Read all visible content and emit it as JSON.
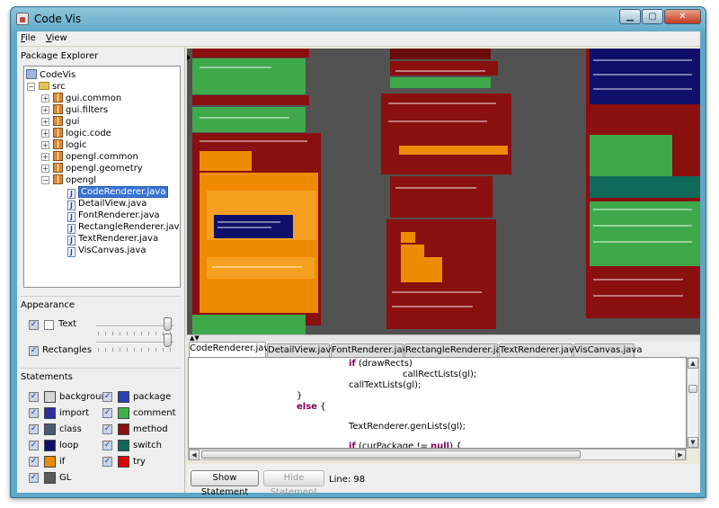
{
  "window": {
    "title": "Code Vis",
    "controls": {
      "minimize": "▁",
      "maximize": "▢",
      "close": "✕"
    }
  },
  "menubar": {
    "items": [
      {
        "label": "File",
        "mnemonic": "F",
        "rest": "ile"
      },
      {
        "label": "View",
        "mnemonic": "V",
        "rest": "iew"
      }
    ]
  },
  "package_explorer": {
    "title": "Package Explorer",
    "tree": [
      {
        "label": "CodeVis",
        "type": "project",
        "depth": 0
      },
      {
        "label": "src",
        "type": "folder",
        "depth": 1,
        "expanded": true
      },
      {
        "label": "gui.common",
        "type": "package",
        "depth": 2
      },
      {
        "label": "gui.filters",
        "type": "package",
        "depth": 2
      },
      {
        "label": "gui",
        "type": "package",
        "depth": 2
      },
      {
        "label": "logic.code",
        "type": "package",
        "depth": 2
      },
      {
        "label": "logic",
        "type": "package",
        "depth": 2
      },
      {
        "label": "opengl.common",
        "type": "package",
        "depth": 2
      },
      {
        "label": "opengl.geometry",
        "type": "package",
        "depth": 2
      },
      {
        "label": "opengl",
        "type": "package",
        "depth": 2,
        "expanded": true
      },
      {
        "label": "CodeRenderer.java",
        "type": "java",
        "depth": 3,
        "selected": true
      },
      {
        "label": "DetailView.java",
        "type": "java",
        "depth": 3
      },
      {
        "label": "FontRenderer.java",
        "type": "java",
        "depth": 3
      },
      {
        "label": "RectangleRenderer.java",
        "type": "java",
        "depth": 3
      },
      {
        "label": "TextRenderer.java",
        "type": "java",
        "depth": 3
      },
      {
        "label": "VisCanvas.java",
        "type": "java",
        "depth": 3
      }
    ]
  },
  "appearance": {
    "title": "Appearance",
    "text": {
      "label": "Text",
      "checked": true,
      "sub_checked": false,
      "level": 1.0
    },
    "rectangles": {
      "label": "Rectangles",
      "checked": true,
      "level": 1.0
    }
  },
  "statements": {
    "title": "Statements",
    "items": [
      {
        "label": "background",
        "checked": true,
        "color": "#d6d6d6"
      },
      {
        "label": "package",
        "checked": true,
        "color": "#2a3fb0"
      },
      {
        "label": "import",
        "checked": true,
        "color": "#2c2ca0"
      },
      {
        "label": "comment",
        "checked": true,
        "color": "#3fb34a"
      },
      {
        "label": "class",
        "checked": true,
        "color": "#4a5a70"
      },
      {
        "label": "method",
        "checked": true,
        "color": "#8a0f0f"
      },
      {
        "label": "loop",
        "checked": true,
        "color": "#10106a"
      },
      {
        "label": "switch",
        "checked": true,
        "color": "#0f6a5a"
      },
      {
        "label": "if",
        "checked": true,
        "color": "#f08a00"
      },
      {
        "label": "try",
        "checked": true,
        "color": "#e00000"
      },
      {
        "label": "GL",
        "checked": true,
        "color": "#5a5a5a"
      }
    ]
  },
  "tabs": [
    {
      "label": "CodeRenderer.java",
      "active": true
    },
    {
      "label": "DetailView.java",
      "active": false
    },
    {
      "label": "FontRenderer.java",
      "active": false
    },
    {
      "label": "RectangleRenderer.java",
      "active": false
    },
    {
      "label": "TextRenderer.java",
      "active": false
    },
    {
      "label": "VisCanvas.java",
      "active": false
    }
  ],
  "code": {
    "lines": [
      {
        "kw": "if",
        "text": " (drawRects)"
      },
      {
        "kw": "",
        "text": "callRectLists(gl);"
      },
      {
        "kw": "",
        "text": "callTextLists(gl);"
      },
      {
        "kw": "",
        "text": "}"
      },
      {
        "kw": "else",
        "text": " {"
      },
      {
        "kw": "",
        "text": "TextRenderer.genLists(gl);"
      },
      {
        "kw": "if",
        "text": " (curPackage != "
      },
      {
        "kw": "null",
        "text": ") {"
      }
    ]
  },
  "bottom": {
    "show_statement": "Show Statement",
    "hide_statement": "Hide Statement",
    "line_info": "Line: 98"
  },
  "colors": {
    "vis_background": "#525252",
    "method": "#8a0f0f",
    "comment": "#3fa84a",
    "if": "#f08a00",
    "loop": "#10106a",
    "selection": "#3875d7"
  }
}
